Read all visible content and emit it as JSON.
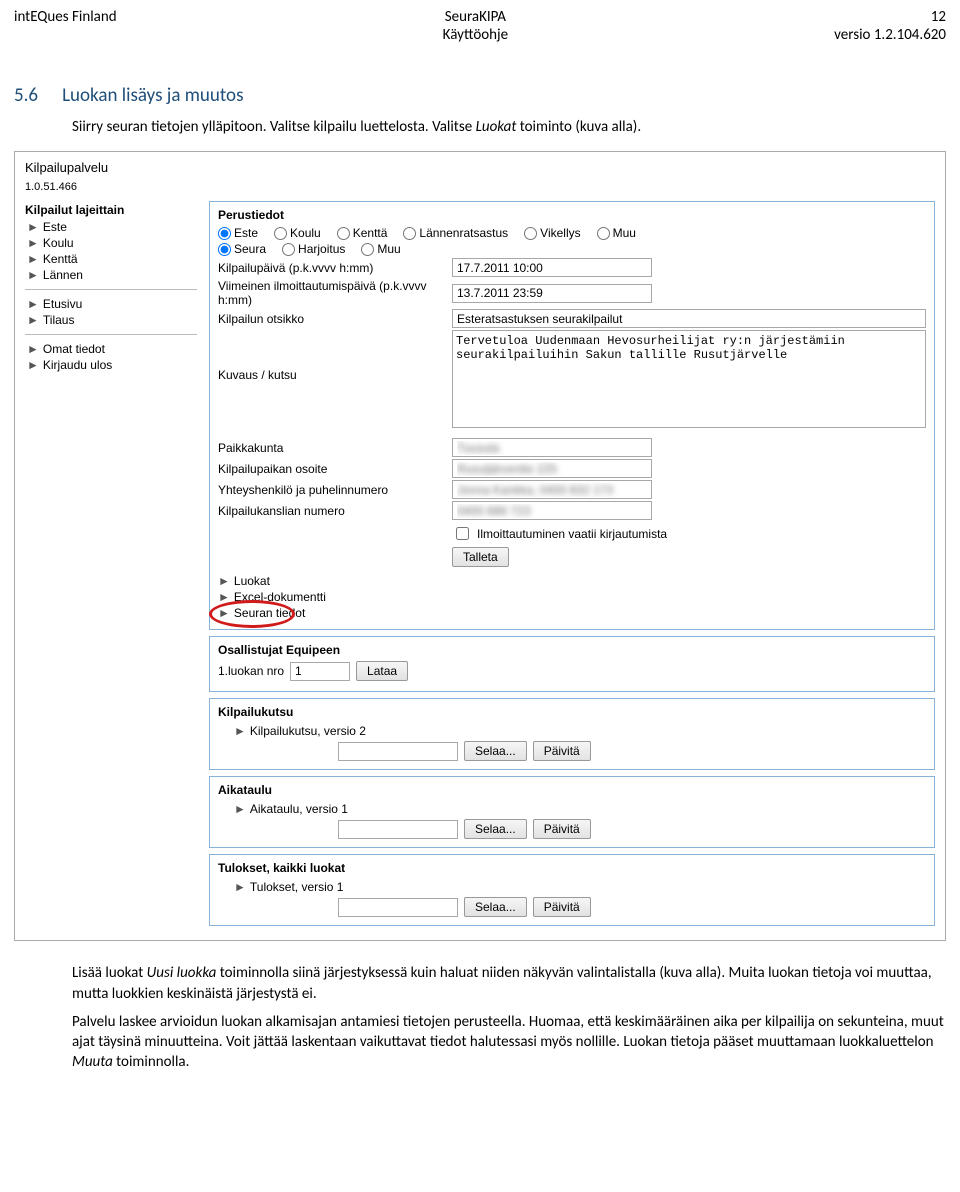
{
  "header": {
    "left": "intEQues Finland",
    "center_top": "SeuraKIPA",
    "center_bottom": "Käyttöohje",
    "right_top": "12",
    "right_bottom": "versio 1.2.104.620"
  },
  "heading": {
    "number": "5.6",
    "title": "Luokan lisäys ja muutos"
  },
  "intro": {
    "p1a": "Siirry seuran tietojen ylläpitoon. Valitse kilpailu luettelosta. Valitse ",
    "p1_em": "Luokat",
    "p1b": " toiminto (kuva alla)."
  },
  "shot": {
    "service": "Kilpailupalvelu",
    "version": "1.0.51.466",
    "sidebar": {
      "group1_title": "Kilpailut lajeittain",
      "group1_items": [
        "Este",
        "Koulu",
        "Kenttä",
        "Lännen"
      ],
      "group2_items": [
        "Etusivu",
        "Tilaus"
      ],
      "group3_items": [
        "Omat tiedot",
        "Kirjaudu ulos"
      ]
    },
    "basic": {
      "title": "Perustiedot",
      "types": [
        "Este",
        "Koulu",
        "Kenttä",
        "Lännenratsastus",
        "Vikellys",
        "Muu"
      ],
      "type_selected": "Este",
      "orgs": [
        "Seura",
        "Harjoitus",
        "Muu"
      ],
      "org_selected": "Seura",
      "date_label": "Kilpailupäivä (p.k.vvvv h:mm)",
      "date_value": "17.7.2011 10:00",
      "lastreg_label": "Viimeinen ilmoittautumispäivä (p.k.vvvv h:mm)",
      "lastreg_value": "13.7.2011 23:59",
      "title_label": "Kilpailun otsikko",
      "title_value": "Esteratsastuksen seurakilpailut",
      "desc_label": "Kuvaus / kutsu",
      "desc_value": "Tervetuloa Uudenmaan Hevosurheilijat ry:n järjestämiin seurakilpailuihin Sakun tallille Rusutjärvelle",
      "city_label": "Paikkakunta",
      "city_value": "Tuusula",
      "addr_label": "Kilpailupaikan osoite",
      "addr_value": "Rusutjärventie 225",
      "contact_label": "Yhteyshenkilö ja puhelinnumero",
      "contact_value": "Jonna Kankka, 0400 832 173",
      "office_label": "Kilpailukanslian numero",
      "office_value": "0400 886 723",
      "login_req_label": "Ilmoittautuminen vaatii kirjautumista",
      "save_btn": "Talleta"
    },
    "footer_links": [
      "Luokat",
      "Excel-dokumentti",
      "Seuran tiedot"
    ],
    "equipe": {
      "title": "Osallistujat Equipeen",
      "class_label": "1.luokan nro",
      "class_value": "1",
      "load_btn": "Lataa"
    },
    "kutsu": {
      "title": "Kilpailukutsu",
      "link": "Kilpailukutsu, versio 2",
      "browse": "Selaa...",
      "update": "Päivitä"
    },
    "aikataulu": {
      "title": "Aikataulu",
      "link": "Aikataulu, versio 1",
      "browse": "Selaa...",
      "update": "Päivitä"
    },
    "tulokset": {
      "title": "Tulokset, kaikki luokat",
      "link": "Tulokset, versio 1",
      "browse": "Selaa...",
      "update": "Päivitä"
    }
  },
  "para2a": "Lisää luokat ",
  "para2_em": "Uusi luokka",
  "para2b": " toiminnolla siinä järjestyksessä kuin haluat niiden näkyvän valintalistalla (kuva alla). Muita luokan tietoja voi muuttaa, mutta luokkien keskinäistä järjestystä ei.",
  "para3a": "Palvelu laskee arvioidun luokan alkamisajan antamiesi tietojen perusteella. Huomaa, että keskimääräinen aika per kilpailija on sekunteina, muut ajat täysinä minuutteina. Voit jättää laskentaan vaikuttavat tiedot halutessasi myös nollille. Luokan tietoja pääset muuttamaan luokkaluettelon ",
  "para3_em": "Muuta",
  "para3b": " toiminnolla."
}
